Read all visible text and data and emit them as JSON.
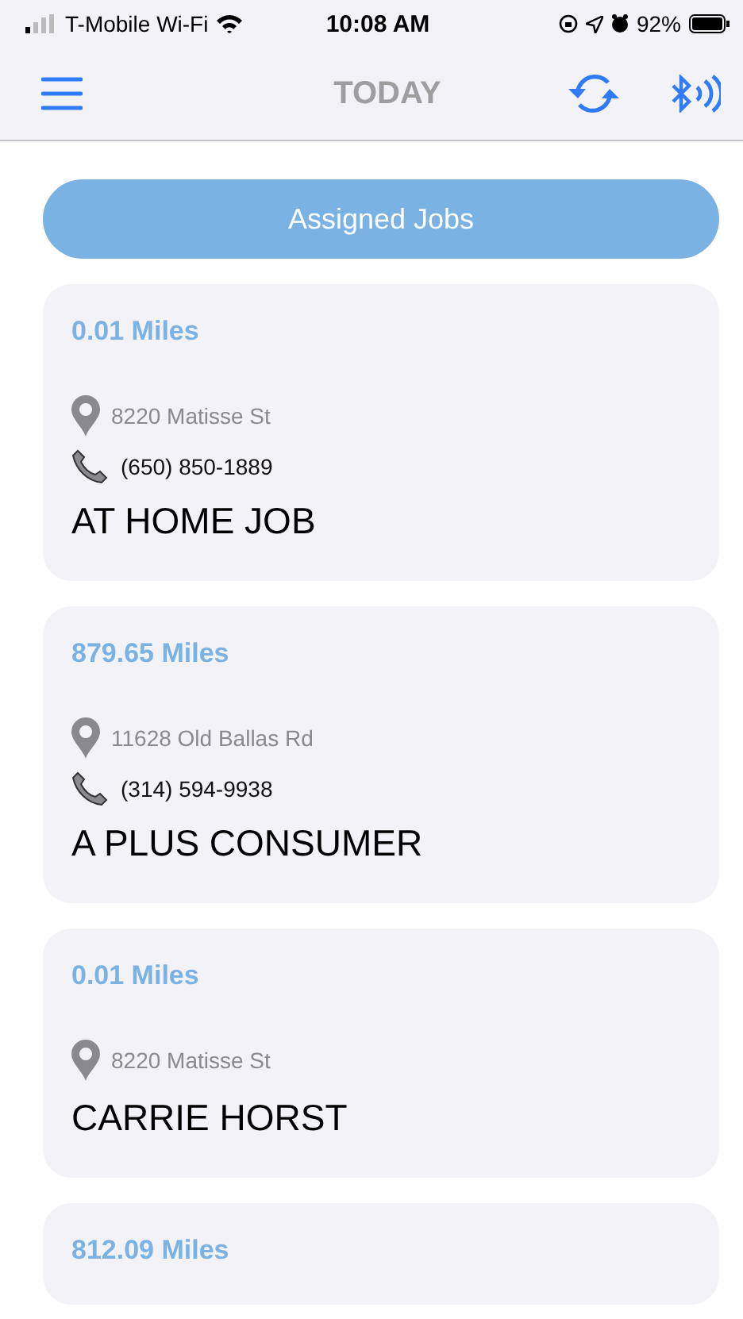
{
  "status_bar": {
    "carrier": "T-Mobile Wi-Fi",
    "time": "10:08 AM",
    "battery": "92%"
  },
  "nav": {
    "title": "TODAY"
  },
  "section_button": "Assigned Jobs",
  "jobs": [
    {
      "distance": "0.01 Miles",
      "address": "8220 Matisse St",
      "phone": "(650) 850-1889",
      "name": "AT HOME JOB"
    },
    {
      "distance": "879.65 Miles",
      "address": "11628 Old Ballas Rd",
      "phone": "(314) 594-9938",
      "name": "A PLUS CONSUMER"
    },
    {
      "distance": "0.01 Miles",
      "address": "8220 Matisse St",
      "name": "CARRIE HORST"
    },
    {
      "distance": "812.09 Miles"
    }
  ]
}
